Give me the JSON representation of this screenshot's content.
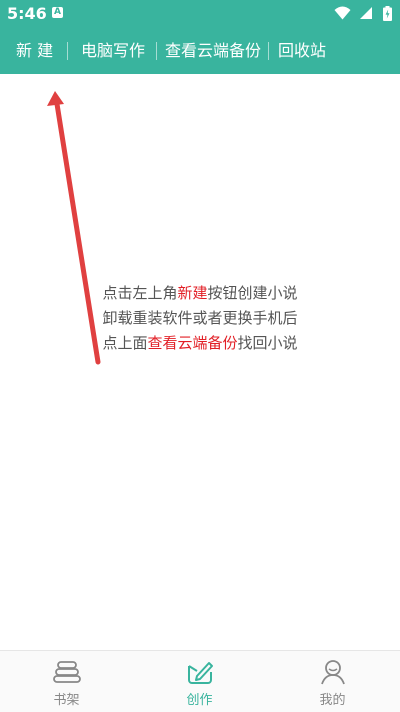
{
  "status_bar": {
    "time": "5:46",
    "notification_icon": "A",
    "icons": [
      "wifi-icon",
      "signal-icon",
      "battery-icon"
    ]
  },
  "toolbar": {
    "new_label": "新 建",
    "pc_write_label": "电脑写作",
    "cloud_backup_label": "查看云端备份",
    "recycle_label": "回收站"
  },
  "hint": {
    "line1": {
      "before": "点击左上角",
      "highlight": "新建",
      "after": "按钮创建小说"
    },
    "line2": "卸载重装软件或者更换手机后",
    "line3": {
      "before": "点上面",
      "highlight": "查看云端备份",
      "after": "找回小说"
    }
  },
  "bottom_nav": {
    "items": [
      {
        "label": "书架",
        "icon": "bookshelf-icon",
        "active": false
      },
      {
        "label": "创作",
        "icon": "write-icon",
        "active": true
      },
      {
        "label": "我的",
        "icon": "profile-icon",
        "active": false
      }
    ]
  },
  "colors": {
    "primary": "#39b49e",
    "highlight": "#e21f26",
    "arrow": "#e04040"
  }
}
